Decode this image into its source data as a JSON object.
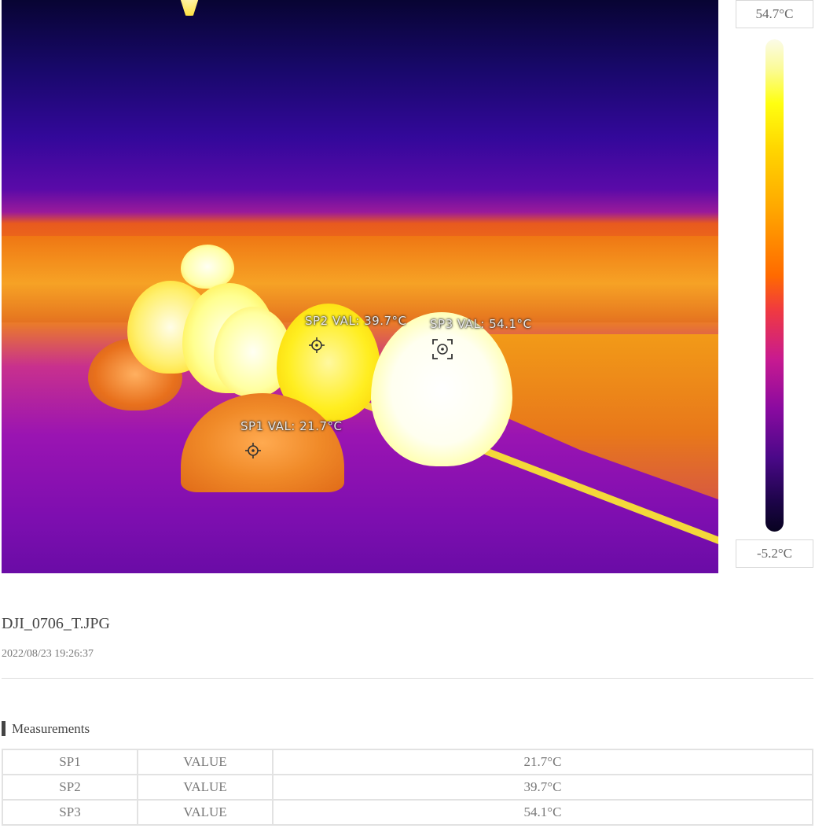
{
  "scale": {
    "max_label": "54.7°C",
    "min_label": "-5.2°C"
  },
  "spots": [
    {
      "name": "SP1",
      "label": "SP1 VAL: 21.7°C"
    },
    {
      "name": "SP2",
      "label": "SP2 VAL: 39.7°C"
    },
    {
      "name": "SP3",
      "label": "SP3 VAL: 54.1°C"
    }
  ],
  "file": {
    "name": "DJI_0706_T.JPG",
    "datetime": "2022/08/23 19:26:37"
  },
  "measurements": {
    "title": "Measurements",
    "rows": [
      {
        "spot": "SP1",
        "type": "VALUE",
        "value": "21.7°C"
      },
      {
        "spot": "SP2",
        "type": "VALUE",
        "value": "39.7°C"
      },
      {
        "spot": "SP3",
        "type": "VALUE",
        "value": "54.1°C"
      }
    ]
  }
}
